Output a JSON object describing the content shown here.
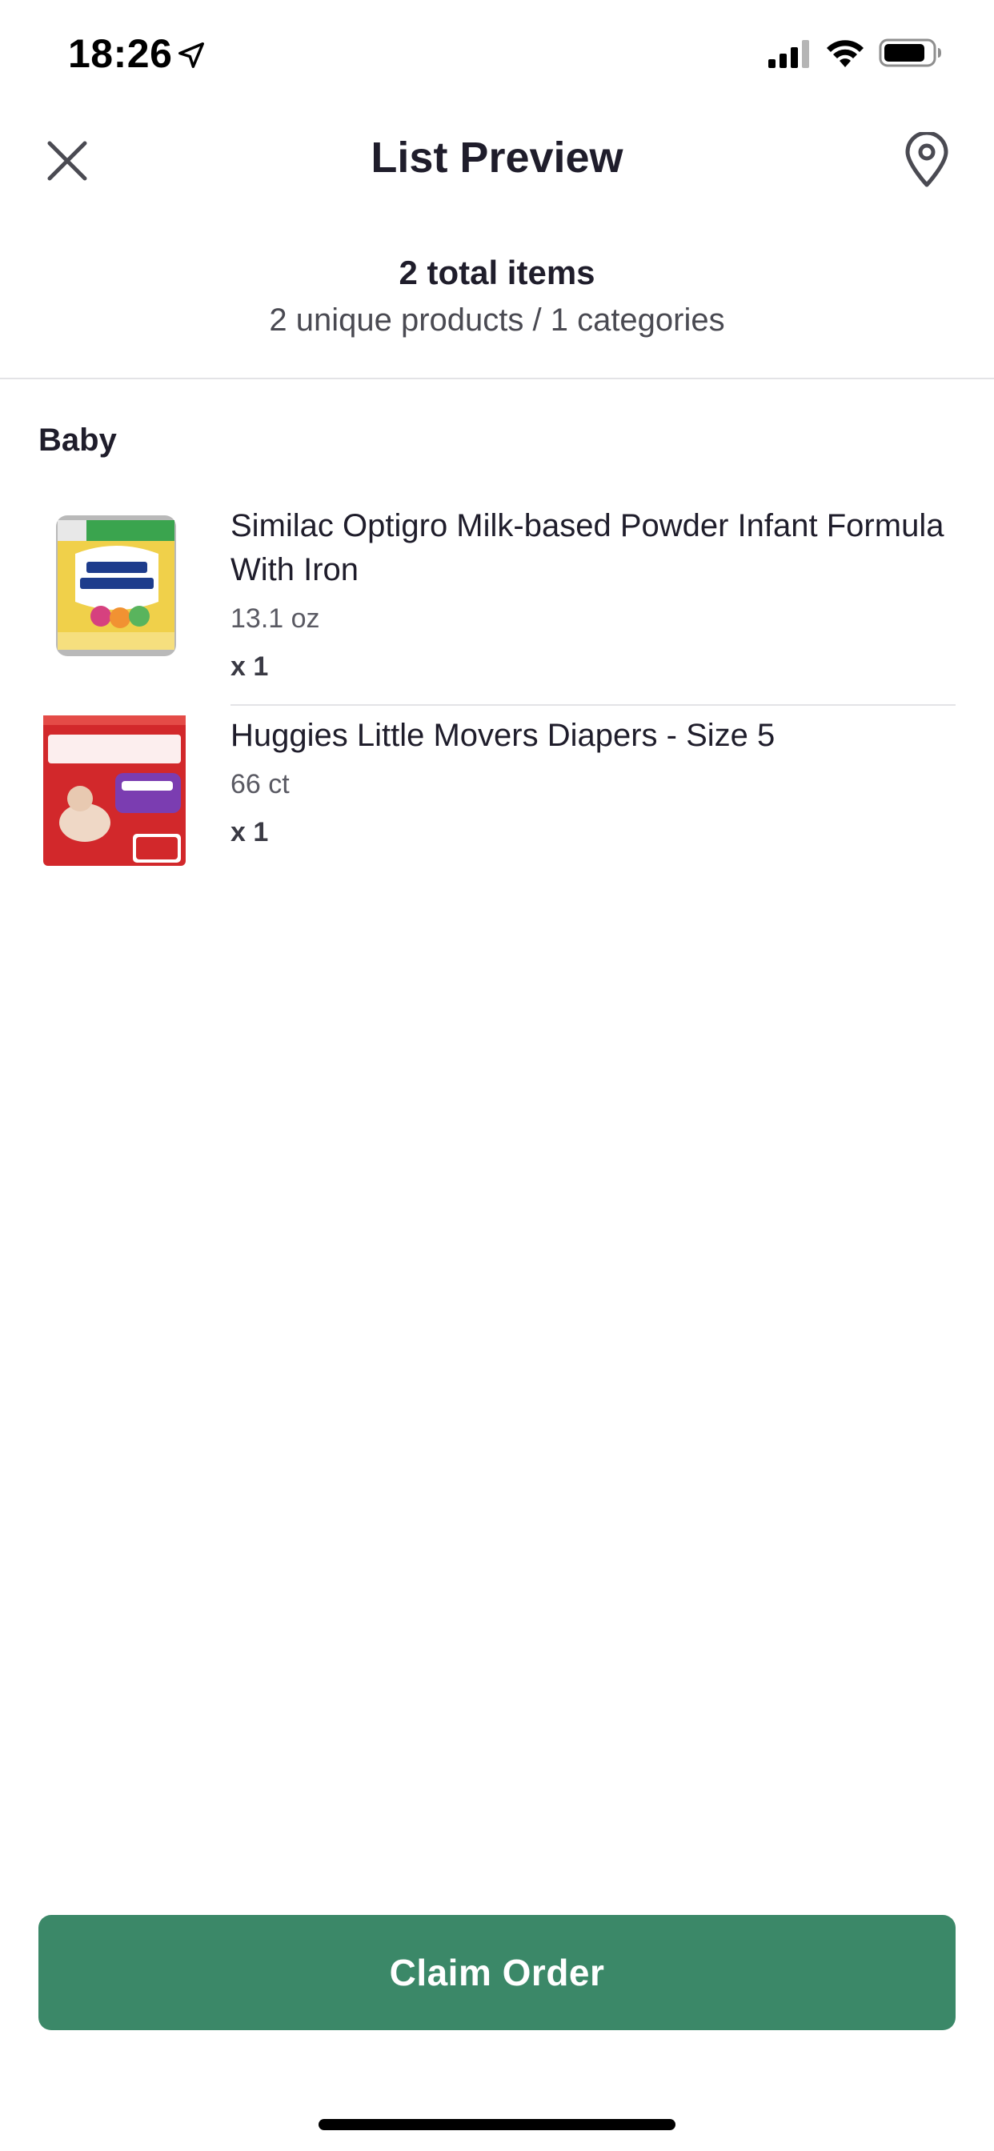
{
  "status_bar": {
    "time": "18:26"
  },
  "header": {
    "title": "List Preview"
  },
  "summary": {
    "total": "2 total items",
    "detail": "2 unique products / 1 categories"
  },
  "category": {
    "name": "Baby",
    "items": [
      {
        "name": "Similac Optigro Milk-based Powder Infant Formula With Iron",
        "size": "13.1 oz",
        "quantity": "x 1"
      },
      {
        "name": "Huggies Little Movers Diapers - Size 5",
        "size": "66 ct",
        "quantity": "x 1"
      }
    ]
  },
  "action": {
    "claim_label": "Claim Order"
  },
  "colors": {
    "accent": "#3b8868",
    "text": "#1f1d2b"
  }
}
